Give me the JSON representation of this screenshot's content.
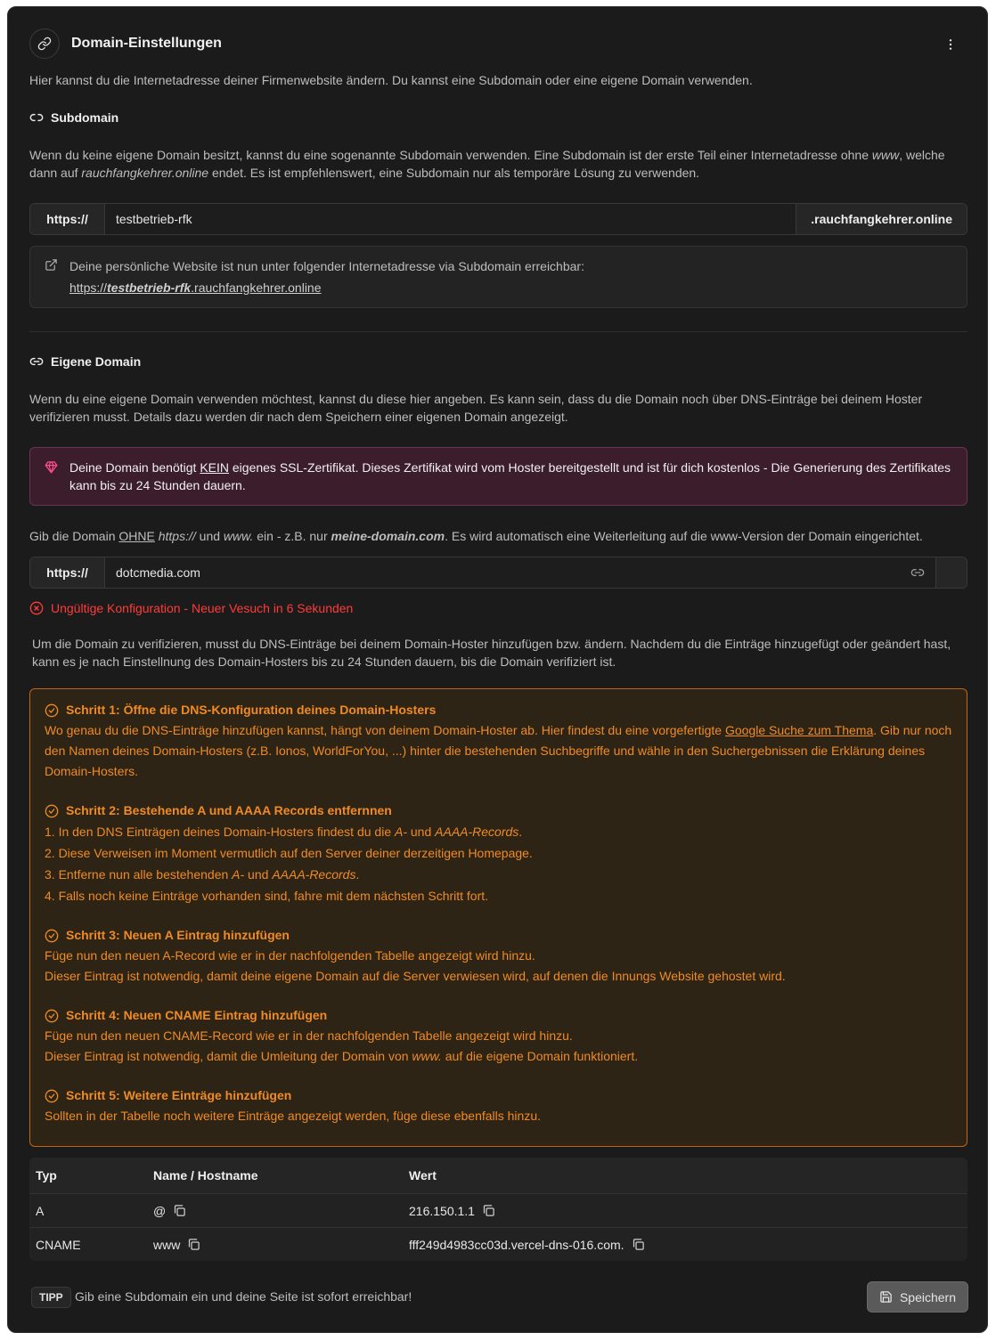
{
  "header": {
    "title": "Domain-Einstellungen",
    "description": "Hier kannst du die Internetadresse deiner Firmenwebsite ändern. Du kannst eine Subdomain oder eine eigene Domain verwenden."
  },
  "subdomain": {
    "title": "Subdomain",
    "desc_1": "Wenn du keine eigene Domain besitzt, kannst du eine sogenannte Subdomain verwenden. Eine Subdomain ist der erste Teil einer Internetadresse ohne ",
    "desc_www": "www",
    "desc_2": ", welche dann auf ",
    "desc_domain": "rauchfangkehrer.online",
    "desc_3": " endet. Es ist empfehlenswert, eine Subdomain nur als temporäre Lösung zu verwenden.",
    "prefix": "https://",
    "value": "testbetrieb-rfk",
    "suffix": ".rauchfangkehrer.online",
    "info_text": "Deine persönliche Website ist nun unter folgender Internetadresse via Subdomain erreichbar:",
    "link_prefix": "https://",
    "link_sub": "testbetrieb-rfk",
    "link_suffix": ".rauchfangkehrer.online"
  },
  "custom_domain": {
    "title": "Eigene Domain",
    "desc": "Wenn du eine eigene Domain verwenden möchtest, kannst du diese hier angeben. Es kann sein, dass du die Domain noch über DNS-Einträge bei deinem Hoster verifizieren musst. Details dazu werden dir nach dem Speichern einer eigenen Domain angezeigt.",
    "alert_1": "Deine Domain benötigt ",
    "alert_kein": "KEIN",
    "alert_2": " eigenes SSL-Zertifikat. Dieses Zertifikat wird vom Hoster bereitgestellt und ist für dich kostenlos - Die Generierung des Zertifikates kann bis zu 24 Stunden dauern.",
    "hint_1": "Gib die Domain ",
    "hint_ohne": "OHNE",
    "hint_2": " ",
    "hint_https": "https://",
    "hint_3": " und ",
    "hint_www": "www.",
    "hint_4": " ein - z.B. nur ",
    "hint_example": "meine-domain.com",
    "hint_5": ". Es wird automatisch eine Weiterleitung auf die www-Version der Domain eingerichtet.",
    "prefix": "https://",
    "value": "dotcmedia.com",
    "error": "Ungültige Konfiguration - Neuer Vesuch in 6 Sekunden",
    "verify_text": "Um die Domain zu verifizieren, musst du DNS-Einträge bei deinem Domain-Hoster hinzufügen bzw. ändern. Nachdem du die Einträge hinzugefügt oder geändert hast, kann es je nach Einstellnung des Domain-Hosters bis zu 24 Stunden dauern, bis die Domain verifiziert ist."
  },
  "steps": {
    "s1_title": "Schritt 1: Öffne die DNS-Konfiguration deines Domain-Hosters",
    "s1_a": "Wo genau du die DNS-Einträge hinzufügen kannst, hängt von deinem Domain-Hoster ab. Hier findest du eine vorgefertigte ",
    "s1_link": "Google Suche zum Thema",
    "s1_b": ". Gib nur noch den Namen deines Domain-Hosters (z.B. Ionos, WorldForYou, ...) hinter die bestehenden Suchbegriffe und wähle in den Suchergebnissen die Erklärung deines Domain-Hosters.",
    "s2_title": "Schritt 2: Bestehende A und AAAA Records entfernnen",
    "s2_l1a": "1. In den DNS Einträgen deines Domain-Hosters findest du die ",
    "s2_a": "A-",
    "s2_und": " und ",
    "s2_aaaa": "AAAA-Records",
    "s2_dot": ".",
    "s2_l2": "2. Diese Verweisen im Moment vermutlich auf den Server deiner derzeitigen Homepage.",
    "s2_l3a": "3. Entferne nun alle bestehenden ",
    "s2_l4": "4. Falls noch keine Einträge vorhanden sind, fahre mit dem nächsten Schritt fort.",
    "s3_title": "Schritt 3: Neuen A Eintrag hinzufügen",
    "s3_l1": "Füge nun den neuen A-Record wie er in der nachfolgenden Tabelle angezeigt wird hinzu.",
    "s3_l2": "Dieser Eintrag ist notwendig, damit deine eigene Domain auf die Server verwiesen wird, auf denen die Innungs Website gehostet wird.",
    "s4_title": "Schritt 4: Neuen CNAME Eintrag hinzufügen",
    "s4_l1": "Füge nun den neuen CNAME-Record wie er in der nachfolgenden Tabelle angezeigt wird hinzu.",
    "s4_l2a": "Dieser Eintrag ist notwendig, damit die Umleitung der Domain von ",
    "s4_www": "www.",
    "s4_l2b": " auf die eigene Domain funktioniert.",
    "s5_title": "Schritt 5: Weitere Einträge hinzufügen",
    "s5_l1": "Sollten in der Tabelle noch weitere Einträge angezeigt werden, füge diese ebenfalls hinzu."
  },
  "dns_table": {
    "headers": [
      "Typ",
      "Name / Hostname",
      "Wert"
    ],
    "rows": [
      {
        "type": "A",
        "name": "@",
        "value": "216.150.1.1"
      },
      {
        "type": "CNAME",
        "name": "www",
        "value": "fff249d4983cc03d.vercel-dns-016.com."
      }
    ]
  },
  "footer": {
    "tip_badge": "TIPP",
    "tip_text": "Gib eine Subdomain ein und deine Seite ist sofort erreichbar!",
    "save_label": "Speichern"
  },
  "colors": {
    "background": "#1b1b1b",
    "accent_orange": "#f08a24",
    "error_red": "#ff3b3b",
    "alert_bg": "#3b1d2c",
    "alert_icon": "#ff4f8b"
  },
  "icons": [
    "link-icon",
    "more-vertical-icon",
    "external-link-icon",
    "gem-icon",
    "x-circle-icon",
    "check-circle-icon",
    "copy-icon",
    "save-icon"
  ]
}
